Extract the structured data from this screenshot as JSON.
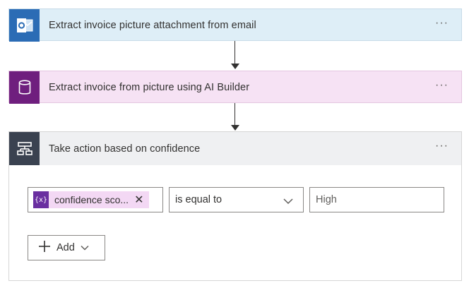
{
  "flow": {
    "step1": {
      "title": "Extract invoice picture attachment from email",
      "icon": "outlook-icon",
      "more": "···"
    },
    "step2": {
      "title": "Extract invoice from picture using AI Builder",
      "icon": "database-icon",
      "more": "···"
    },
    "step3": {
      "title": "Take action based on confidence",
      "icon": "condition-icon",
      "more": "···",
      "condition": {
        "token_icon_text": "{x}",
        "token_label": "confidence sco...",
        "token_remove": "✕",
        "operator": "is equal to",
        "value_placeholder": "High"
      },
      "add_label": "Add"
    }
  },
  "colors": {
    "outlook_blue": "#2b6cb5",
    "ai_builder_purple": "#6f1f7e",
    "condition_dark": "#3a4250",
    "token_purple": "#6a2fa0"
  }
}
